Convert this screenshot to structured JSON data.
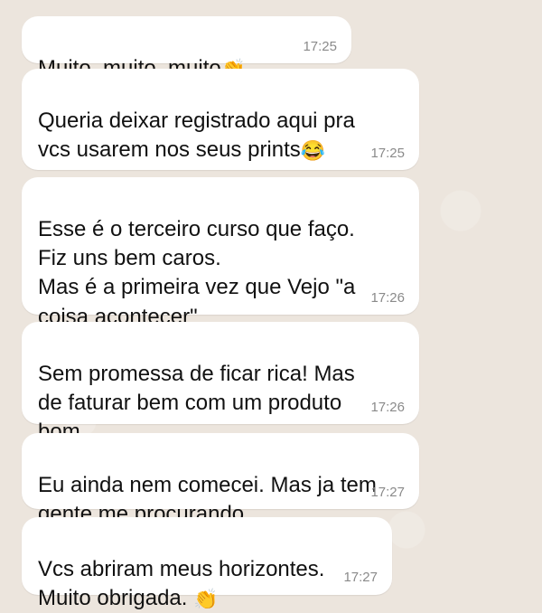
{
  "messages": [
    {
      "text": "Muito, muito, muito",
      "emoji": "👏",
      "time": "17:25"
    },
    {
      "text": "Queria deixar registrado aqui pra\nvcs usarem nos seus prints",
      "emoji": "😂",
      "time": "17:25"
    },
    {
      "text": "Esse é o terceiro curso que faço.\nFiz uns bem caros.\nMas é a primeira vez que Vejo \"a\ncoisa acontecer\"",
      "emoji": "",
      "time": "17:26"
    },
    {
      "text": "Sem promessa de ficar rica! Mas\nde faturar bem com um produto\nbom",
      "emoji": "",
      "time": "17:26"
    },
    {
      "text": "Eu ainda nem comecei. Mas ja tem\ngente me procurando.",
      "emoji": "",
      "time": "17:27"
    },
    {
      "text": "Vcs abriram meus horizontes.\nMuito obrigada. ",
      "emoji": "👏",
      "time": "17:27"
    }
  ]
}
